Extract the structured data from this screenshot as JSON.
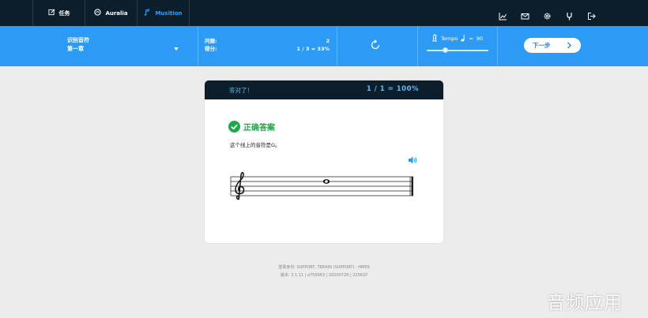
{
  "nav": {
    "tabs": [
      {
        "label": "任务",
        "icon": "edit-icon"
      },
      {
        "label": "Auralia",
        "icon": "auralia-logo-icon"
      },
      {
        "label": "Musition",
        "icon": "musition-logo-icon"
      }
    ],
    "right_icons": [
      "chart-icon",
      "mail-icon",
      "settings-icon",
      "tuning-fork-icon",
      "logout-icon"
    ],
    "active_color": "#2aa1ff"
  },
  "toolbar": {
    "lesson_title": "识别音符",
    "lesson_chapter": "第一章",
    "questions_label": "问题:",
    "questions_value": "2",
    "score_label": "得分:",
    "score_value": "1 / 3 = 33%",
    "tempo_label": "Tempo",
    "tempo_eq": "=",
    "tempo_value": "90",
    "tempo_level": 0.3,
    "next_label": "下一步",
    "bar_color": "#2d9bf5"
  },
  "card": {
    "status": "答对了！",
    "score": "1 / 1 = 100%",
    "result_title": "正确答案",
    "explanation": "这个线上的音符是G。",
    "result_color": "#1da84a"
  },
  "footer": {
    "line1": "登录身份: SUPPORT, TREAIN (SUPPORT) - HMES",
    "line2": "版本: 3.1.11 | a759963 | 20200729 | 22561P"
  },
  "watermark": "音频应用"
}
